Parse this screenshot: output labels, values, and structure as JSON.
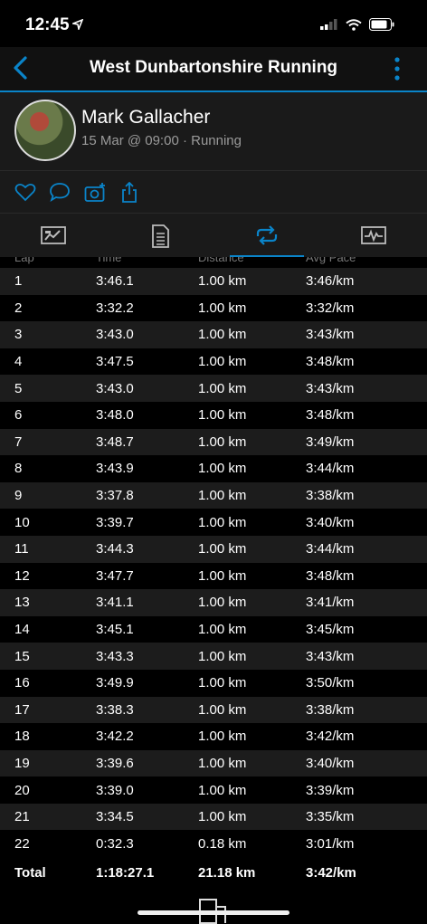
{
  "status_bar": {
    "time": "12:45"
  },
  "nav": {
    "title": "West Dunbartonshire Running"
  },
  "profile": {
    "name": "Mark Gallacher",
    "subtitle": "15 Mar @ 09:00 · Running"
  },
  "table": {
    "headers": [
      "Lap",
      "Time",
      "Distance",
      "Avg Pace"
    ],
    "rows": [
      {
        "lap": "1",
        "time": "3:46.1",
        "distance": "1.00 km",
        "pace": "3:46/km"
      },
      {
        "lap": "2",
        "time": "3:32.2",
        "distance": "1.00 km",
        "pace": "3:32/km"
      },
      {
        "lap": "3",
        "time": "3:43.0",
        "distance": "1.00 km",
        "pace": "3:43/km"
      },
      {
        "lap": "4",
        "time": "3:47.5",
        "distance": "1.00 km",
        "pace": "3:48/km"
      },
      {
        "lap": "5",
        "time": "3:43.0",
        "distance": "1.00 km",
        "pace": "3:43/km"
      },
      {
        "lap": "6",
        "time": "3:48.0",
        "distance": "1.00 km",
        "pace": "3:48/km"
      },
      {
        "lap": "7",
        "time": "3:48.7",
        "distance": "1.00 km",
        "pace": "3:49/km"
      },
      {
        "lap": "8",
        "time": "3:43.9",
        "distance": "1.00 km",
        "pace": "3:44/km"
      },
      {
        "lap": "9",
        "time": "3:37.8",
        "distance": "1.00 km",
        "pace": "3:38/km"
      },
      {
        "lap": "10",
        "time": "3:39.7",
        "distance": "1.00 km",
        "pace": "3:40/km"
      },
      {
        "lap": "11",
        "time": "3:44.3",
        "distance": "1.00 km",
        "pace": "3:44/km"
      },
      {
        "lap": "12",
        "time": "3:47.7",
        "distance": "1.00 km",
        "pace": "3:48/km"
      },
      {
        "lap": "13",
        "time": "3:41.1",
        "distance": "1.00 km",
        "pace": "3:41/km"
      },
      {
        "lap": "14",
        "time": "3:45.1",
        "distance": "1.00 km",
        "pace": "3:45/km"
      },
      {
        "lap": "15",
        "time": "3:43.3",
        "distance": "1.00 km",
        "pace": "3:43/km"
      },
      {
        "lap": "16",
        "time": "3:49.9",
        "distance": "1.00 km",
        "pace": "3:50/km"
      },
      {
        "lap": "17",
        "time": "3:38.3",
        "distance": "1.00 km",
        "pace": "3:38/km"
      },
      {
        "lap": "18",
        "time": "3:42.2",
        "distance": "1.00 km",
        "pace": "3:42/km"
      },
      {
        "lap": "19",
        "time": "3:39.6",
        "distance": "1.00 km",
        "pace": "3:40/km"
      },
      {
        "lap": "20",
        "time": "3:39.0",
        "distance": "1.00 km",
        "pace": "3:39/km"
      },
      {
        "lap": "21",
        "time": "3:34.5",
        "distance": "1.00 km",
        "pace": "3:35/km"
      },
      {
        "lap": "22",
        "time": "0:32.3",
        "distance": "0.18 km",
        "pace": "3:01/km"
      }
    ],
    "total": {
      "lap": "Total",
      "time": "1:18:27.1",
      "distance": "21.18 km",
      "pace": "3:42/km"
    }
  },
  "colors": {
    "accent": "#0a84c9",
    "background": "#000000",
    "row_alt": "#1c1c1c",
    "panel": "#1a1a1a"
  },
  "icons": [
    "location-arrow-icon",
    "signal-icon",
    "wifi-icon",
    "battery-icon",
    "back-chevron-icon",
    "more-vertical-icon",
    "heart-icon",
    "comment-icon",
    "camera-add-icon",
    "share-icon",
    "summary-tab-icon",
    "details-tab-icon",
    "laps-tab-icon",
    "charts-tab-icon"
  ]
}
